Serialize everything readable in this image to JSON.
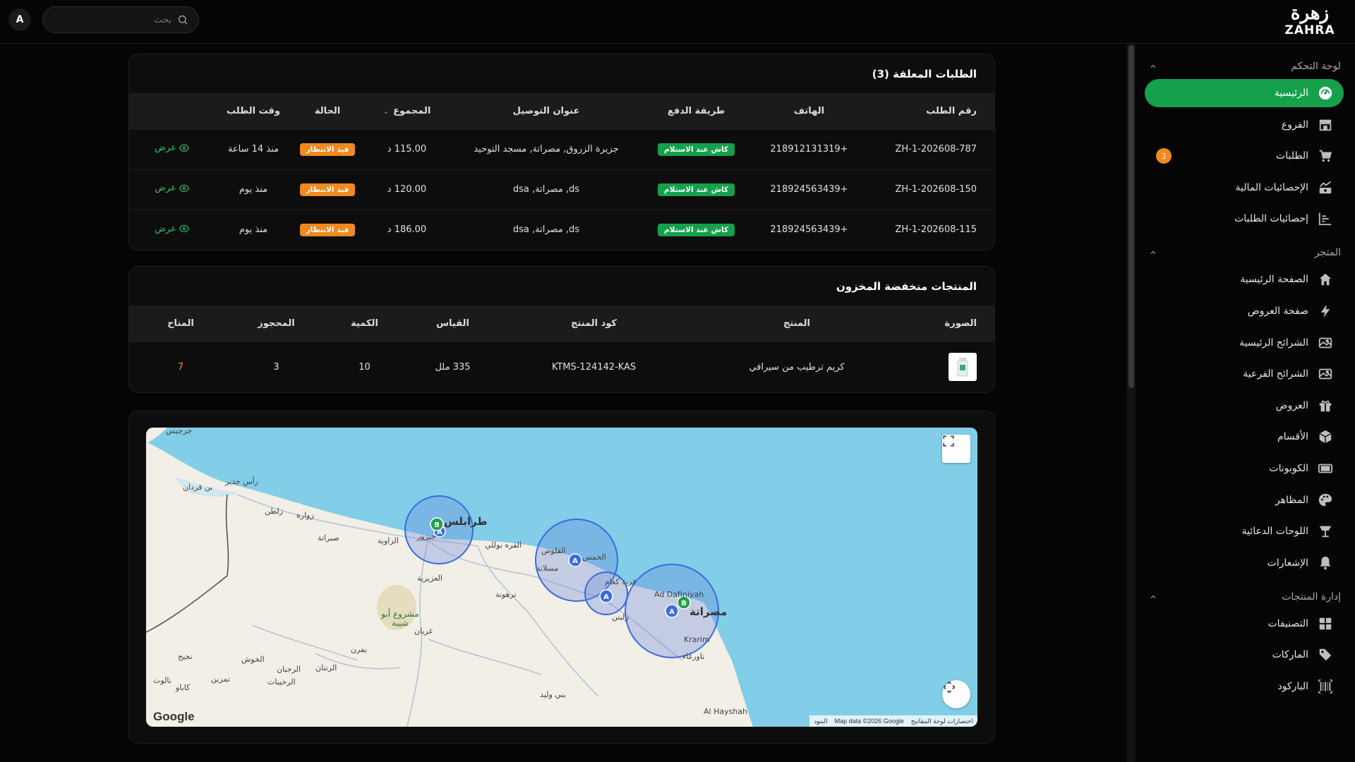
{
  "header": {
    "avatar_letter": "A",
    "search_placeholder": "بحث",
    "logo_ar": "زهرة",
    "logo_en": "ZAHRA"
  },
  "sidebar": {
    "groups": [
      {
        "title": "لوحة التحكم",
        "items": [
          {
            "label": "الرئيسية",
            "icon": "dashboard-icon",
            "active": true
          },
          {
            "label": "الفروع",
            "icon": "store-icon"
          },
          {
            "label": "الطلبات",
            "icon": "cart-icon",
            "badge": "3"
          },
          {
            "label": "الإحصائيات المالية",
            "icon": "finance-chart-icon"
          },
          {
            "label": "إحصائيات الطلبات",
            "icon": "bar-list-icon"
          }
        ]
      },
      {
        "title": "المتجر",
        "items": [
          {
            "label": "الصفحة الرئيسية",
            "icon": "home-icon"
          },
          {
            "label": "صفحة العروض",
            "icon": "lightning-icon"
          },
          {
            "label": "الشرائح الرئيسية",
            "icon": "image-icon"
          },
          {
            "label": "الشرائح الفرعية",
            "icon": "image-icon"
          },
          {
            "label": "العروض",
            "icon": "gift-icon"
          },
          {
            "label": "الأقسام",
            "icon": "box-icon"
          },
          {
            "label": "الكوبونات",
            "icon": "ticket-icon"
          },
          {
            "label": "المظاهر",
            "icon": "palette-icon"
          },
          {
            "label": "اللوحات الدعائية",
            "icon": "billboard-icon"
          },
          {
            "label": "الإشعارات",
            "icon": "bell-icon"
          }
        ]
      },
      {
        "title": "إدارة المنتجات",
        "items": [
          {
            "label": "التصنيفات",
            "icon": "grid-icon"
          },
          {
            "label": "الماركات",
            "icon": "tag-icon"
          },
          {
            "label": "الباركود",
            "icon": "barcode-icon"
          }
        ]
      }
    ]
  },
  "pending_orders": {
    "title": "الطلبات المعلقة (3)",
    "columns": [
      "رقم الطلب",
      "الهاتف",
      "طريقة الدفع",
      "عنوان التوصيل",
      "المجموع",
      "الحالة",
      "وقت الطلب",
      ""
    ],
    "view_label": "عرض",
    "rows": [
      {
        "id": "ZH-1-202608-787",
        "phone": "+218912131319",
        "payment": "كاش عند الاستلام",
        "address": "جزيرة الزروق, مصراتة, مسجد التوحيد",
        "total": "115.00 د",
        "status": "قيد الانتظار",
        "time": "منذ 14 ساعة"
      },
      {
        "id": "ZH-1-202608-150",
        "phone": "+218924563439",
        "payment": "كاش عند الاستلام",
        "address": "ds, مصراتة, dsa",
        "total": "120.00 د",
        "status": "قيد الانتظار",
        "time": "منذ يوم"
      },
      {
        "id": "ZH-1-202608-115",
        "phone": "+218924563439",
        "payment": "كاش عند الاستلام",
        "address": "ds, مصراتة, dsa",
        "total": "186.00 د",
        "status": "قيد الانتظار",
        "time": "منذ يوم"
      }
    ]
  },
  "low_stock": {
    "title": "المنتجات منخفضة المخزون",
    "columns": [
      "الصورة",
      "المنتج",
      "كود المنتج",
      "القياس",
      "الكمية",
      "المحجوز",
      "المتاح"
    ],
    "rows": [
      {
        "product": "كريم ترطيب من سيرافي",
        "code": "KTMS-124142-KAS",
        "size": "335 ملل",
        "qty": "10",
        "reserved": "3",
        "available": "7"
      }
    ]
  },
  "map": {
    "google_label": "Google",
    "attribution": [
      "البنود",
      "Map data ©2026 Google",
      "اختصارات لوحة المفاتيح"
    ],
    "cities": [
      "رأس جدير",
      "بن قردان",
      "زلطن",
      "زوارة",
      "صبراتة",
      "الزاوية",
      "طرابلس",
      "جنزور",
      "القره بوللي",
      "العزيزية",
      "مشروع أبو شيبة",
      "غريان",
      "يفرن",
      "الزنتان",
      "الرحيبات",
      "الخوش",
      "نالوت",
      "كاباو",
      "نجيح",
      "تمزين",
      "الرجبان",
      "ترهونة",
      "الخمس",
      "القلوص",
      "مسلاتة",
      "زليتن",
      "قرية كعام",
      "Ad Dafiniyah",
      "مصراتة",
      "Krarim",
      "تاورغاء",
      "بني وليد",
      "Al Hayshah",
      "جرجيس"
    ],
    "markers": [
      "A",
      "B"
    ]
  },
  "colors": {
    "accent": "#15a04b",
    "warning": "#f0891e",
    "background": "#050505",
    "card": "#0d0d0d"
  }
}
